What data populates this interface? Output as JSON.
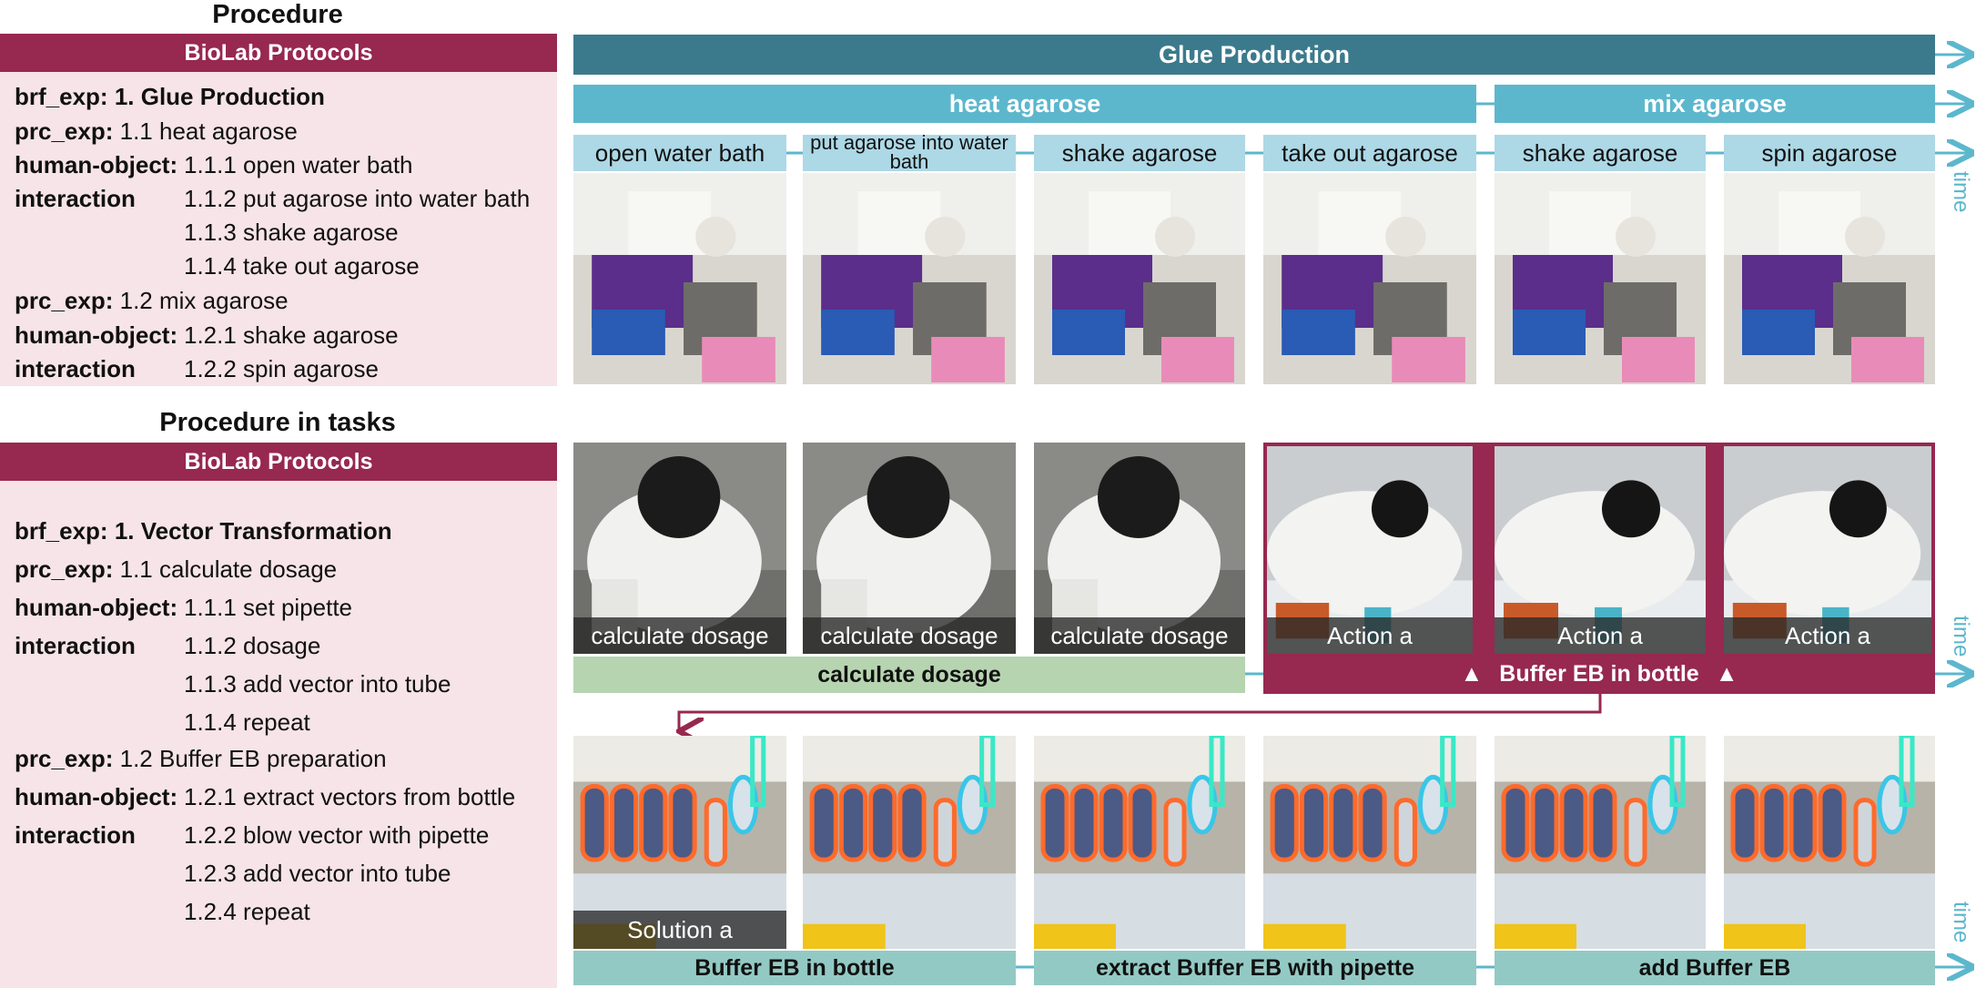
{
  "top_left": {
    "title": "Procedure",
    "banner": "BioLab Protocols",
    "brf_key": "brf_exp:",
    "brf_value": "1. Glue Production",
    "prc1_key": "prc_exp:",
    "prc1_value": "1.1 heat agarose",
    "hoi1_key": "human-object:",
    "hoi1_key2": "interaction",
    "steps1": [
      "1.1.1 open water bath",
      "1.1.2 put agarose into water bath",
      "1.1.3 shake agarose",
      "1.1.4 take out agarose"
    ],
    "prc2_key": "prc_exp:",
    "prc2_value": "1.2 mix agarose",
    "hoi2_key": "human-object:",
    "hoi2_key2": "interaction",
    "steps2": [
      "1.2.1 shake agarose",
      "1.2.2 spin agarose"
    ]
  },
  "bottom_left": {
    "title": "Procedure in tasks",
    "banner": "BioLab Protocols",
    "brf_key": "brf_exp:",
    "brf_value": "1. Vector Transformation",
    "prc1_key": "prc_exp:",
    "prc1_value": "1.1 calculate dosage",
    "hoi1_key": "human-object:",
    "hoi1_key2": "interaction",
    "steps1": [
      "1.1.1 set pipette",
      "1.1.2 dosage",
      "1.1.3 add vector into tube",
      "1.1.4 repeat"
    ],
    "prc2_key": "prc_exp:",
    "prc2_value": "1.2 Buffer EB preparation",
    "hoi2_key": "human-object:",
    "hoi2_key2": "interaction",
    "steps2": [
      "1.2.1 extract vectors from bottle",
      "1.2.2 blow vector with pipette",
      "1.2.3 add vector into tube",
      "1.2.4 repeat"
    ]
  },
  "row1": {
    "task": "Glue Production",
    "subtasks": [
      "heat agarose",
      "mix agarose"
    ],
    "actions": [
      "open water bath",
      "put agarose into water bath",
      "shake agarose",
      "take out agarose",
      "shake agarose",
      "spin agarose"
    ]
  },
  "row2": {
    "captions": [
      "calculate dosage",
      "calculate dosage",
      "calculate dosage",
      "Action a",
      "Action a",
      "Action a"
    ],
    "green_label": "calculate dosage",
    "maroon_label": "Buffer EB in bottle",
    "triangle_glyph": "▲"
  },
  "row3": {
    "caption": "Solution a",
    "labels": [
      "Buffer EB in bottle",
      "extract Buffer EB with pipette",
      "add Buffer EB"
    ]
  },
  "time_label": "time",
  "colors": {
    "maroon": "#97284f",
    "panel": "#f6e4e8",
    "steel": "#3b7a8c",
    "teal": "#5cb7cd",
    "light_blue": "#add8e6",
    "green": "#b6d4b0",
    "mint": "#93c9c4"
  }
}
